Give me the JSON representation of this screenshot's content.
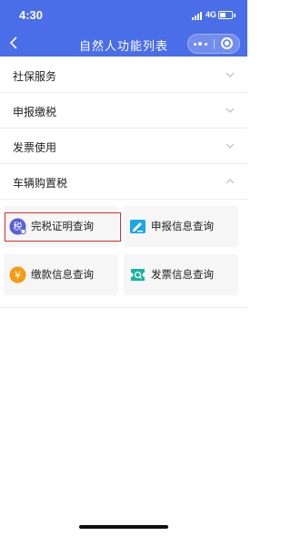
{
  "status_bar": {
    "time": "4:30",
    "network": "4G"
  },
  "header": {
    "title": "自然人功能列表"
  },
  "sections": [
    {
      "label": "社保服务",
      "expanded": false
    },
    {
      "label": "申报缴税",
      "expanded": false
    },
    {
      "label": "发票使用",
      "expanded": false
    },
    {
      "label": "车辆购置税",
      "expanded": true
    }
  ],
  "tiles": [
    {
      "label": "完税证明查询",
      "icon": "tax-certificate-icon",
      "icon_glyph": "税",
      "color": "#5b5fd6"
    },
    {
      "label": "申报信息查询",
      "icon": "declaration-edit-icon",
      "color": "#1aa6e8"
    },
    {
      "label": "缴款信息查询",
      "icon": "yuan-payment-icon",
      "icon_glyph": "¥",
      "color": "#f39c12"
    },
    {
      "label": "发票信息查询",
      "icon": "invoice-ticket-icon",
      "color": "#16b3a0"
    }
  ],
  "colors": {
    "header": "#4a6ee8",
    "highlight": "#e12b2b"
  }
}
